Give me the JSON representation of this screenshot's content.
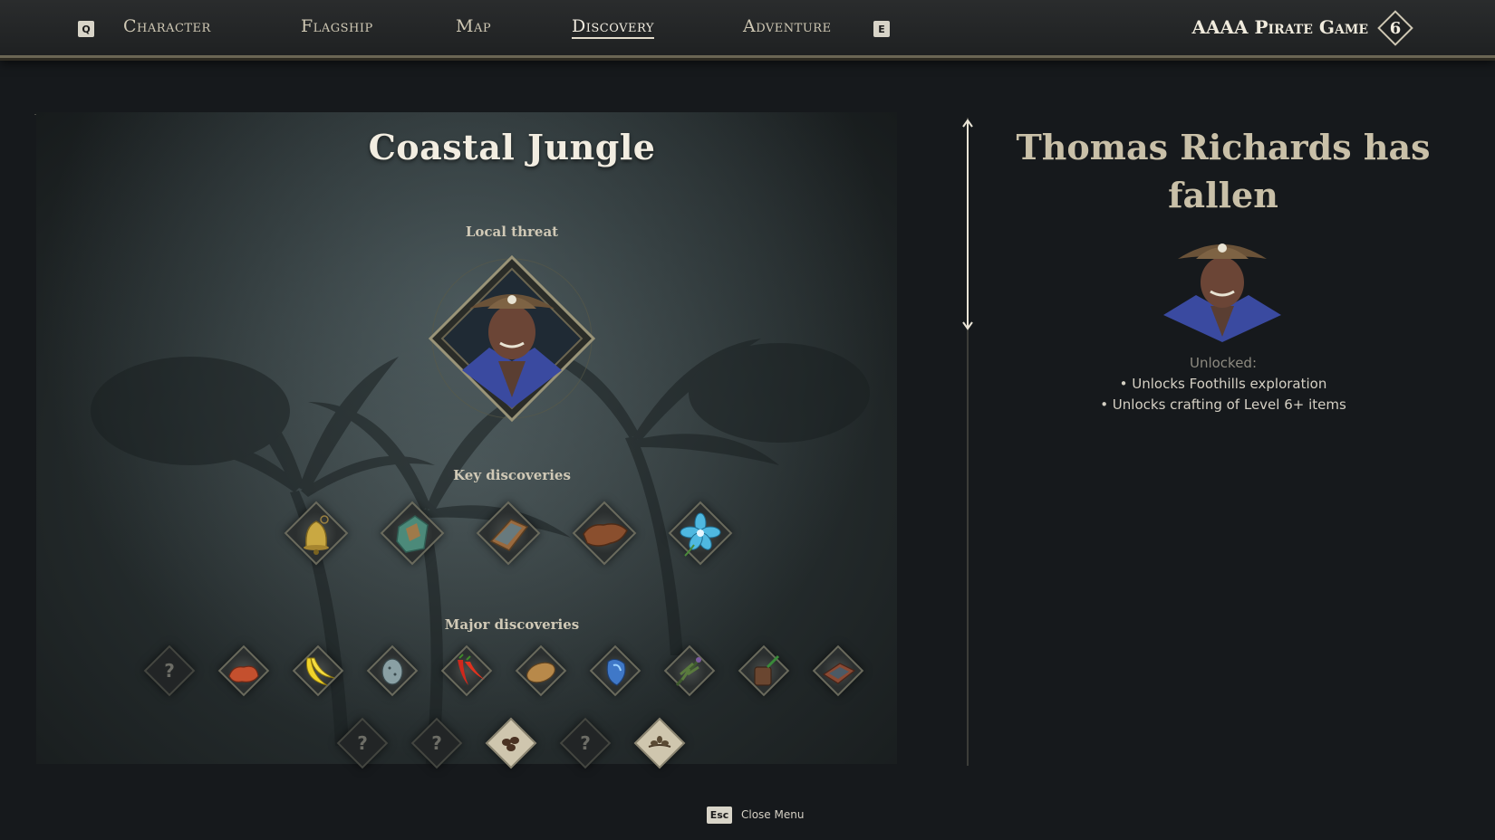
{
  "nav": {
    "left_key": "Q",
    "right_key": "E",
    "tabs": [
      {
        "label": "Character"
      },
      {
        "label": "Flagship"
      },
      {
        "label": "Map"
      },
      {
        "label": "Discovery",
        "active": true
      },
      {
        "label": "Adventure"
      }
    ],
    "game_title": "AAAA Pirate Game",
    "level": "6"
  },
  "region": {
    "title": "Coastal Jungle",
    "local_threat_label": "Local threat",
    "key_discoveries_label": "Key discoveries",
    "major_discoveries_label": "Major discoveries",
    "key_discoveries": [
      {
        "icon": "bell-icon"
      },
      {
        "icon": "copper-ore-icon"
      },
      {
        "icon": "iron-ingot-icon"
      },
      {
        "icon": "animal-hide-icon"
      },
      {
        "icon": "blue-flower-icon"
      }
    ],
    "major_discoveries_row1": [
      {
        "icon": "unknown-icon",
        "locked": true,
        "label": "?"
      },
      {
        "icon": "red-meat-icon"
      },
      {
        "icon": "banana-icon"
      },
      {
        "icon": "egg-icon"
      },
      {
        "icon": "chili-pepper-icon"
      },
      {
        "icon": "potato-icon"
      },
      {
        "icon": "blue-crystal-icon"
      },
      {
        "icon": "herb-bundle-icon"
      },
      {
        "icon": "bucket-icon"
      },
      {
        "icon": "crate-icon"
      }
    ],
    "major_discoveries_row2": [
      {
        "icon": "unknown-icon",
        "locked": true,
        "label": "?"
      },
      {
        "icon": "unknown-icon",
        "locked": true,
        "label": "?"
      },
      {
        "icon": "seeds-icon"
      },
      {
        "icon": "unknown-icon",
        "locked": true,
        "label": "?"
      },
      {
        "icon": "sprout-icon"
      }
    ]
  },
  "threat_detail": {
    "title": "Thomas Richards has fallen",
    "unlocked_label": "Unlocked:",
    "unlocks": [
      "• Unlocks Foothills exploration",
      "• Unlocks crafting of Level 6+ items"
    ]
  },
  "footer": {
    "esc_key": "Esc",
    "close_label": "Close Menu"
  },
  "colors": {
    "background": "#16191c",
    "title_text": "#f2ede1",
    "fallen_title": "#c9c0a8",
    "frame_border": "#6a6a5c"
  }
}
